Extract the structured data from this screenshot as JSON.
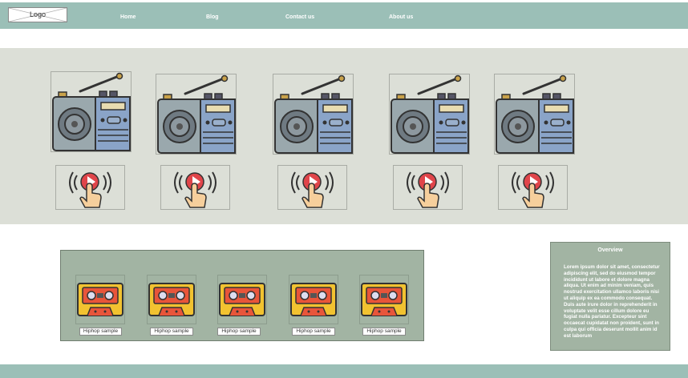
{
  "header": {
    "logo_text": "Logo",
    "nav": [
      {
        "label": "Home"
      },
      {
        "label": "Blog"
      },
      {
        "label": "Contact us"
      },
      {
        "label": "About us"
      }
    ]
  },
  "radios": [
    {
      "icon": "radio-icon",
      "play_icon": "tap-to-play-icon"
    },
    {
      "icon": "radio-icon",
      "play_icon": "tap-to-play-icon"
    },
    {
      "icon": "radio-icon",
      "play_icon": "tap-to-play-icon"
    },
    {
      "icon": "radio-icon",
      "play_icon": "tap-to-play-icon"
    },
    {
      "icon": "radio-icon",
      "play_icon": "tap-to-play-icon"
    }
  ],
  "samples": [
    {
      "label": "Hiphop sample",
      "icon": "cassette-icon"
    },
    {
      "label": "Hiphop sample",
      "icon": "cassette-icon"
    },
    {
      "label": "Hiphop sample",
      "icon": "cassette-icon"
    },
    {
      "label": "Hiphop sample",
      "icon": "cassette-icon"
    },
    {
      "label": "Hiphop sample",
      "icon": "cassette-icon"
    }
  ],
  "overview": {
    "title": "Overview",
    "body": "Lorem ipsum dolor sit amet, consectetur adipiscing elit, sed do eiusmod tempor incididunt ut labore et dolore magna aliqua. Ut enim ad minim veniam, quis nostrud exercitation ullamco laboris nisi ut aliquip ex ea commodo consequat. Duis aute irure dolor in reprehenderit in voluptate velit esse cillum dolore eu fugiat nulla pariatur. Excepteur sint occaecat cupidatat non proident, sunt in culpa qui officia deserunt mollit anim id est laborum"
  },
  "colors": {
    "nav": "#9bbfb7",
    "band": "#dcdfd7",
    "panel": "#a2b4a3"
  }
}
